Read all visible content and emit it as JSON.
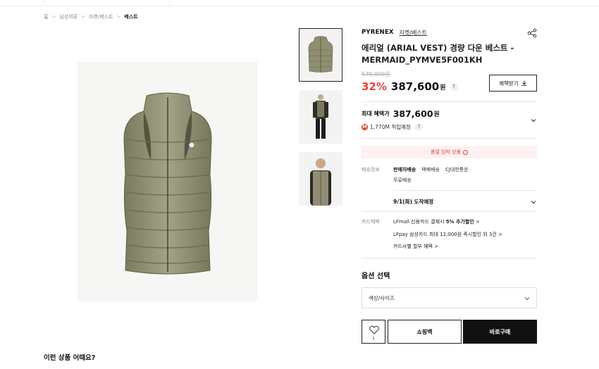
{
  "breadcrumb": [
    "홈",
    "남성의류",
    "자켓/베스트",
    "베스트"
  ],
  "product": {
    "brand": "PYRENEX",
    "category": "자켓/베스트",
    "title": "에리얼 (ARIAL VEST) 경량 다운 베스트 - MERMAID_PYMVE5F001KH",
    "original_price": "570,000원",
    "discount": "32%",
    "price": "387,600",
    "currency": "원",
    "benefit_button": "혜택받기"
  },
  "max_benefit": {
    "label": "최대 혜택가",
    "price": "387,600",
    "currency": "원",
    "points": "1,770M 적립예정",
    "point_badge": "M"
  },
  "alert": "품절 임박 상품",
  "shipping": {
    "label": "배송정보",
    "seller": "판매자배송",
    "type": "택배배송",
    "carrier": "CJ대한통운",
    "fee": "무료배송",
    "eta": "9/1(화) 도착예정"
  },
  "card_benefit": {
    "label": "카드혜택",
    "line1_prefix": "LFmall 신용카드 결제시 ",
    "line1_bold": "5% 추가할인",
    "line2": "LFpay 삼성카드 최대 12,000원 즉시할인 외 3건",
    "line3": "카드사별 할부 혜택"
  },
  "options": {
    "title": "옵션 선택",
    "select_placeholder": "색상/사이즈"
  },
  "actions": {
    "like_count": "1",
    "cart": "쇼핑백",
    "buy": "바로구매"
  },
  "recommend_title": "이런 상품 어때요?",
  "colors": {
    "accent_red": "#e4413b",
    "vest_olive": "#8f8e72"
  }
}
